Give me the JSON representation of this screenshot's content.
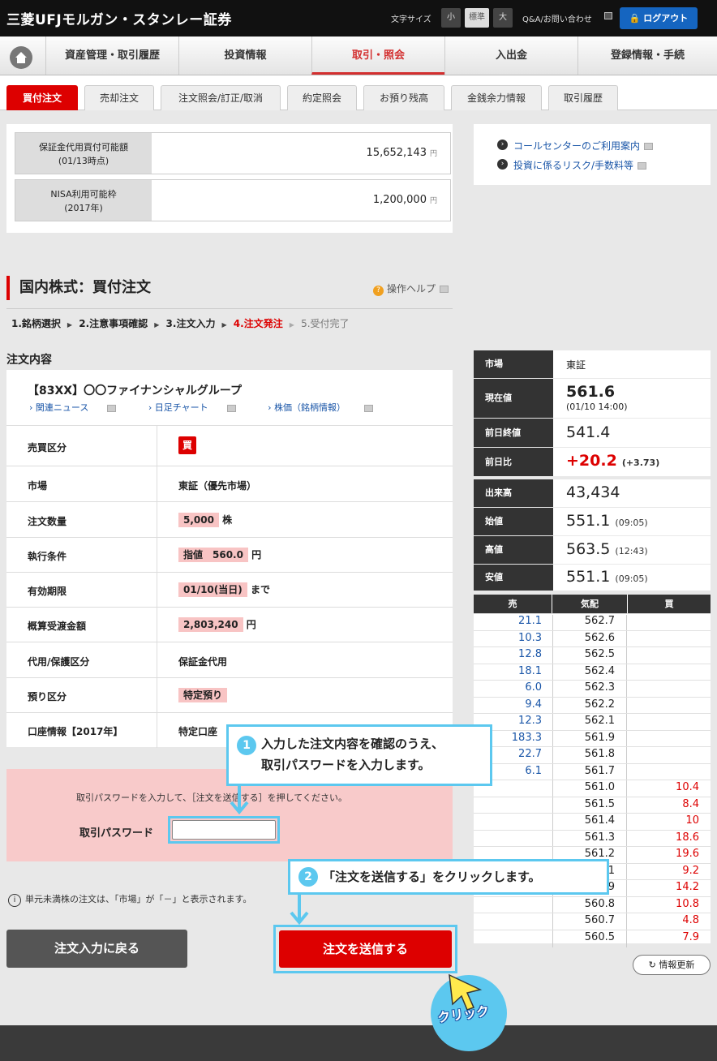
{
  "header": {
    "logo": "三菱UFJモルガン・スタンレー証券",
    "font_size_label": "文字サイズ",
    "font_sizes": [
      "小",
      "標準",
      "大"
    ],
    "qa": "Q&A/お問い合わせ",
    "logout": "ログアウト"
  },
  "nav": {
    "items": [
      "資産管理・取引履歴",
      "投資情報",
      "取引・照会",
      "入出金",
      "登録情報・手続"
    ],
    "active": 2
  },
  "tabs": {
    "items": [
      "買付注文",
      "売却注文",
      "注文照会/訂正/取消",
      "約定照会",
      "お預り残高",
      "金銭余力情報",
      "取引履歴"
    ],
    "active": 0
  },
  "balances": [
    {
      "label1": "保証金代用買付可能額",
      "label2": "(01/13時点)",
      "value": "15,652,143",
      "unit": "円"
    },
    {
      "label1": "NISA利用可能枠",
      "label2": "(2017年)",
      "value": "1,200,000",
      "unit": "円"
    }
  ],
  "links": [
    "コールセンターのご利用案内",
    "投資に係るリスク/手数料等"
  ],
  "page": {
    "title": "国内株式：買付注文",
    "help": "操作ヘルプ"
  },
  "steps": [
    "1.銘柄選択",
    "2.注意事項確認",
    "3.注文入力",
    "4.注文発注",
    "5.受付完了"
  ],
  "order": {
    "heading": "注文内容",
    "stock": "【83XX】〇〇ファイナンシャルグループ",
    "sublinks": [
      "関連ニュース",
      "日足チャート",
      "株価（銘柄情報）"
    ],
    "rows": [
      {
        "label": "売買区分",
        "value": "買"
      },
      {
        "label": "市場",
        "value": "東証（優先市場）"
      },
      {
        "label": "注文数量",
        "value": "5,000",
        "suffix": "株"
      },
      {
        "label": "執行条件",
        "value": "指値　560.0",
        "suffix": "円"
      },
      {
        "label": "有効期限",
        "value": "01/10(当日)",
        "suffix": "まで"
      },
      {
        "label": "概算受渡金額",
        "value": "2,803,240",
        "suffix": "円"
      },
      {
        "label": "代用/保護区分",
        "value": "保証金代用"
      },
      {
        "label": "預り区分",
        "value": "特定預り"
      },
      {
        "label": "口座情報【2017年】",
        "value": "特定口座"
      }
    ]
  },
  "password": {
    "message": "取引パスワードを入力して、［注文を送信する］を押してください。",
    "label": "取引パスワード",
    "value": ""
  },
  "note": "単元未満株の注文は、「市場」が「－」と表示されます。",
  "buttons": {
    "back": "注文入力に戻る",
    "send": "注文を送信する",
    "refresh": "情報更新"
  },
  "quote": [
    {
      "label": "市場",
      "value": "東証"
    },
    {
      "label": "現在値",
      "value": "561.6",
      "sub": "(01/10 14:00)"
    },
    {
      "label": "前日終値",
      "value": "541.4"
    },
    {
      "label": "前日比",
      "value": "+20.2",
      "sub": "(+3.73)"
    },
    {
      "label": "出来高",
      "value": "43,434"
    },
    {
      "label": "始値",
      "value": "551.1",
      "sub": "(09:05)"
    },
    {
      "label": "高値",
      "value": "563.5",
      "sub": "(12:43)"
    },
    {
      "label": "安値",
      "value": "551.1",
      "sub": "(09:05)"
    }
  ],
  "book": {
    "headers": [
      "売",
      "気配",
      "買"
    ],
    "rows": [
      [
        "21.1",
        "562.7",
        ""
      ],
      [
        "10.3",
        "562.6",
        ""
      ],
      [
        "12.8",
        "562.5",
        ""
      ],
      [
        "18.1",
        "562.4",
        ""
      ],
      [
        "6.0",
        "562.3",
        ""
      ],
      [
        "9.4",
        "562.2",
        ""
      ],
      [
        "12.3",
        "562.1",
        ""
      ],
      [
        "183.3",
        "561.9",
        ""
      ],
      [
        "22.7",
        "561.8",
        ""
      ],
      [
        "6.1",
        "561.7",
        ""
      ],
      [
        "",
        "561.0",
        "10.4"
      ],
      [
        "",
        "561.5",
        "8.4"
      ],
      [
        "",
        "561.4",
        "10"
      ],
      [
        "",
        "561.3",
        "18.6"
      ],
      [
        "",
        "561.2",
        "19.6"
      ],
      [
        "",
        "561.1",
        "9.2"
      ],
      [
        "",
        "560.9",
        "14.2"
      ],
      [
        "",
        "560.8",
        "10.8"
      ],
      [
        "",
        "560.7",
        "4.8"
      ],
      [
        "",
        "560.5",
        "7.9"
      ]
    ]
  },
  "callouts": {
    "one_num": "1",
    "one_line1": "入力した注文内容を確認のうえ、",
    "one_line2": "取引パスワードを入力します。",
    "two_num": "2",
    "two_text": "「注文を送信する」をクリックします。",
    "click": "クリック"
  },
  "colors": {
    "accent": "#d00000",
    "link": "#1a56a8",
    "callout": "#5cc8ef"
  }
}
